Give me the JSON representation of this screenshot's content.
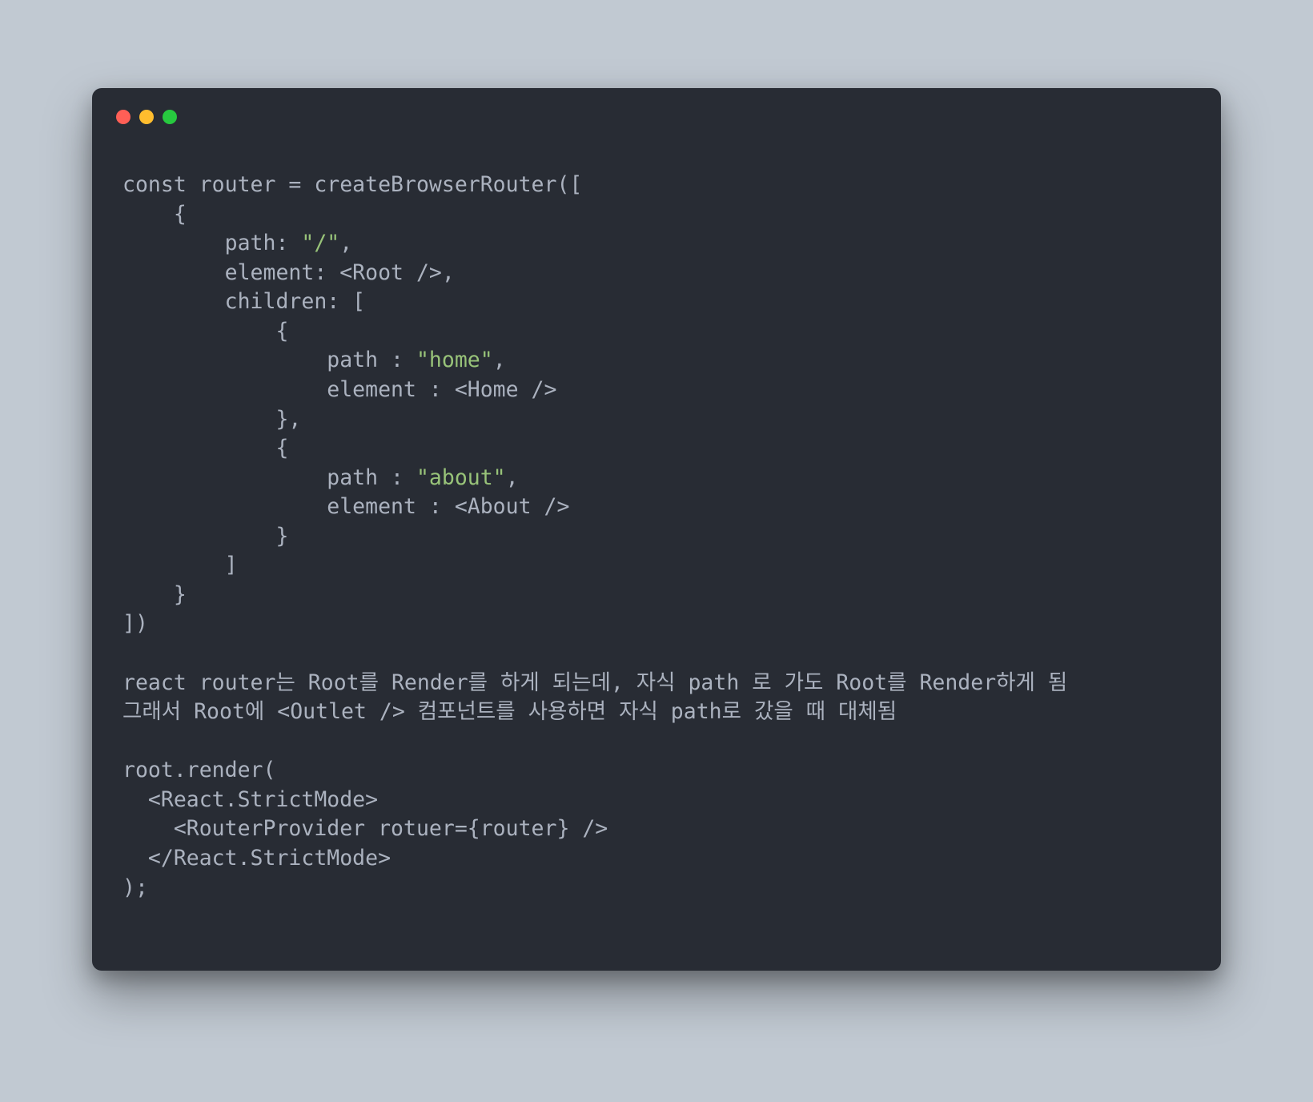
{
  "window": {
    "controls": [
      "close",
      "minimize",
      "zoom"
    ]
  },
  "code": {
    "line1": "const router = createBrowserRouter([",
    "line2": "    {",
    "line3a": "        path: ",
    "line3str": "\"/\"",
    "line3b": ",",
    "line4": "        element: <Root />,",
    "line5": "        children: [",
    "line6": "            {",
    "line7a": "                path : ",
    "line7str": "\"home\"",
    "line7b": ",",
    "line8": "                element : <Home />",
    "line9": "            },",
    "line10": "            {",
    "line11a": "                path : ",
    "line11str": "\"about\"",
    "line11b": ",",
    "line12": "                element : <About />",
    "line13": "            }",
    "line14": "        ]",
    "line15": "    }",
    "line16": "])",
    "line17": "",
    "line18": "react router는 Root를 Render를 하게 되는데, 자식 path 로 가도 Root를 Render하게 됨",
    "line19": "그래서 Root에 <Outlet /> 컴포넌트를 사용하면 자식 path로 갔을 때 대체됨",
    "line20": "",
    "line21": "root.render(",
    "line22": "  <React.StrictMode>",
    "line23": "    <RouterProvider rotuer={router} />",
    "line24": "  </React.StrictMode>",
    "line25": ");"
  }
}
